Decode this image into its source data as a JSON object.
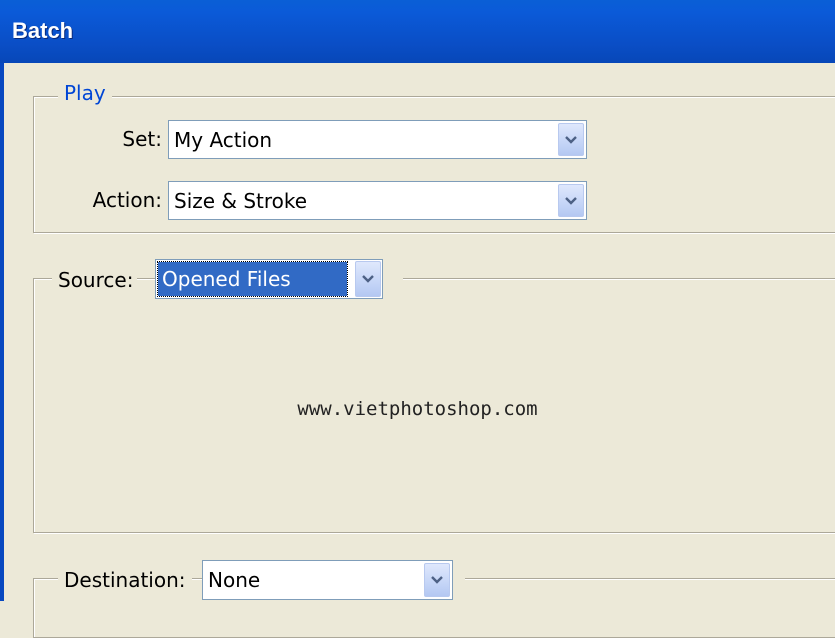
{
  "window": {
    "title": "Batch"
  },
  "play": {
    "legend": "Play",
    "set": {
      "label": "Set:",
      "value": "My Action"
    },
    "action": {
      "label": "Action:",
      "value": "Size & Stroke"
    }
  },
  "source": {
    "label": "Source:",
    "value": "Opened Files"
  },
  "watermark": "www.vietphotoshop.com",
  "destination": {
    "label": "Destination:",
    "value": "None"
  },
  "colors": {
    "titlebar": "#0a5fd6",
    "dialog_bg": "#ece9d8",
    "legend_blue": "#0046d5",
    "selection": "#316ac5"
  }
}
